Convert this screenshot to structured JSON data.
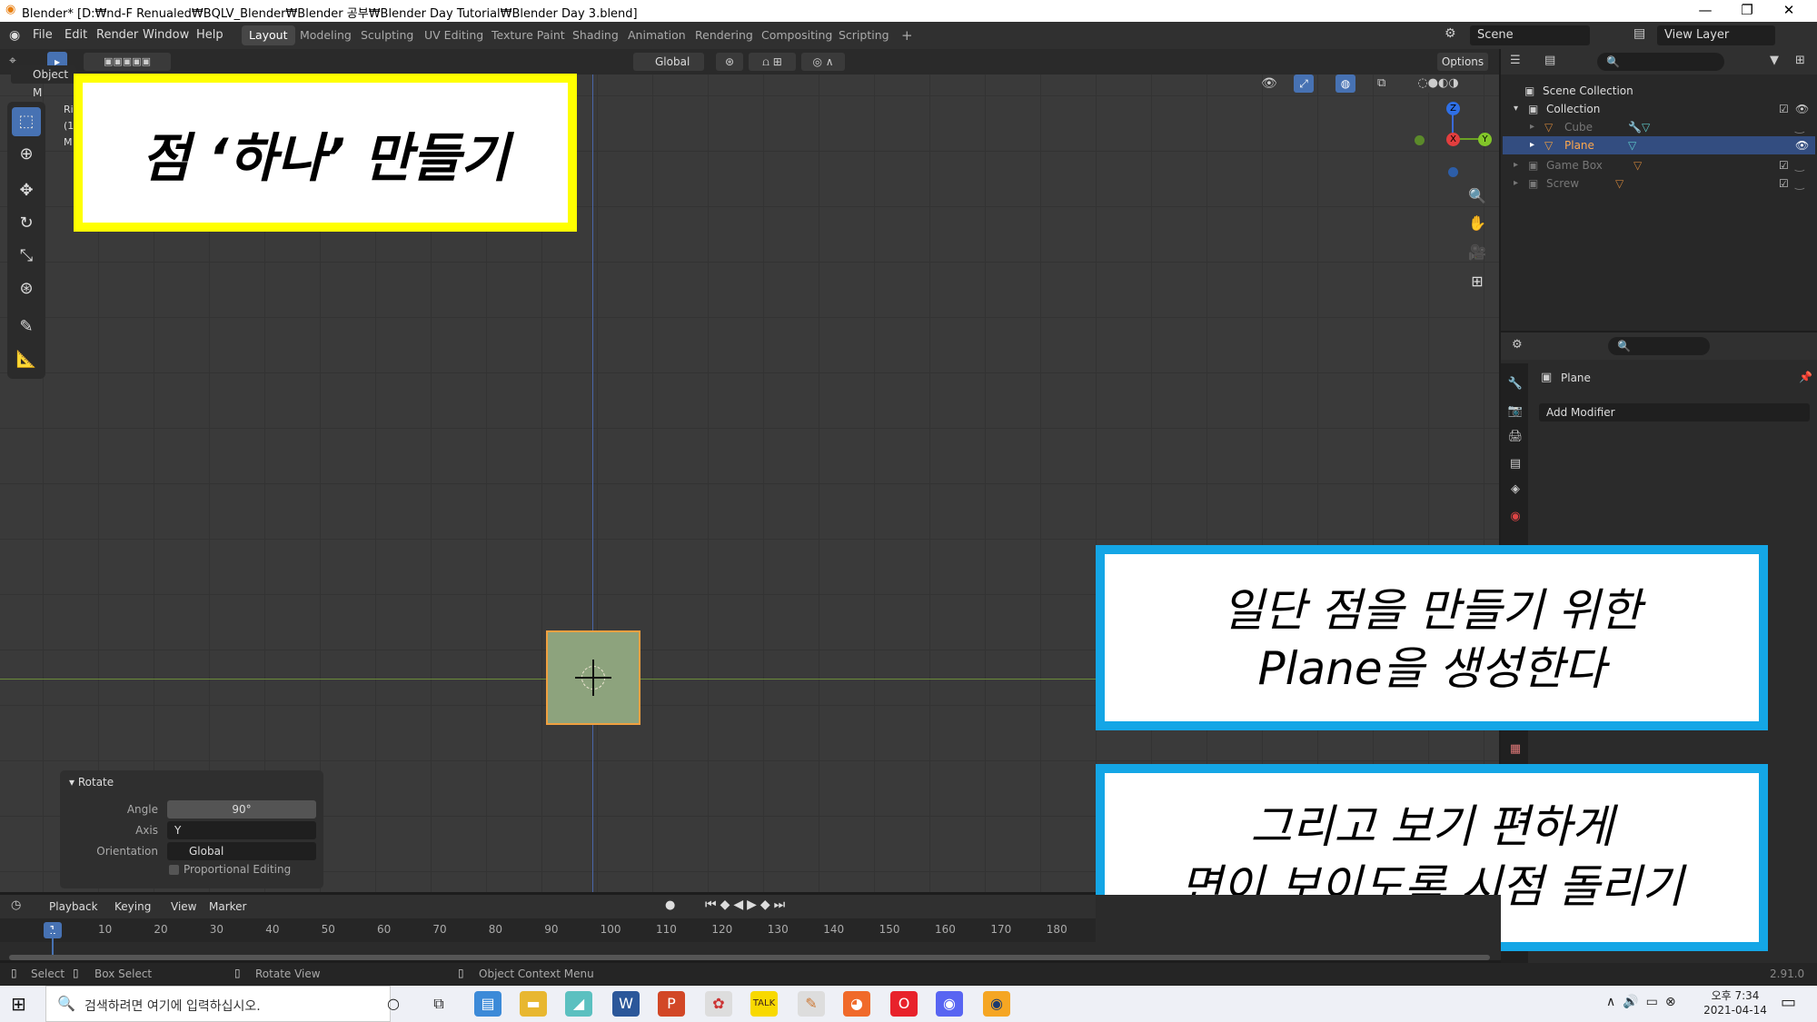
{
  "window": {
    "title": "Blender* [D:₩nd-F Renualed₩BQLV_Blender₩Blender 공부₩Blender Day Tutorial₩Blender Day 3.blend]",
    "controls": {
      "minimize": "—",
      "restore": "❐",
      "close": "✕"
    }
  },
  "menubar": {
    "menus": [
      "File",
      "Edit",
      "Render",
      "Window",
      "Help"
    ],
    "workspaces": [
      "Layout",
      "Modeling",
      "Sculpting",
      "UV Editing",
      "Texture Paint",
      "Shading",
      "Animation",
      "Rendering",
      "Compositing",
      "Scripting"
    ],
    "active_workspace": "Layout",
    "add_tab": "+",
    "scene": "Scene",
    "view_layer": "View Layer"
  },
  "viewport_header": {
    "mode": "Object M",
    "transform_orientation": "Global",
    "options": "Options",
    "overlay_lines": [
      "Ri",
      "(1",
      "M"
    ]
  },
  "rotate_panel": {
    "title": "Rotate",
    "angle_label": "Angle",
    "angle_value": "90°",
    "axis_label": "Axis",
    "axis_value": "Y",
    "orientation_label": "Orientation",
    "orientation_value": "Global",
    "proportional_label": "Proportional Editing"
  },
  "gizmo": {
    "z": "Z",
    "x": "X",
    "y": "Y"
  },
  "outliner": {
    "root": "Scene Collection",
    "collection": "Collection",
    "items": [
      {
        "name": "Cube"
      },
      {
        "name": "Plane"
      },
      {
        "name": "Game Box"
      },
      {
        "name": "Screw"
      }
    ]
  },
  "properties": {
    "object_name": "Plane",
    "add_modifier": "Add Modifier"
  },
  "timeline": {
    "menus": [
      "Playback",
      "Keying",
      "View",
      "Marker"
    ],
    "current_frame": "1",
    "ticks": [
      "10",
      "20",
      "30",
      "40",
      "50",
      "60",
      "70",
      "80",
      "90",
      "100",
      "110",
      "120",
      "130",
      "140",
      "150",
      "160",
      "170",
      "180"
    ]
  },
  "statusbar": {
    "select": "Select",
    "box_select": "Box Select",
    "rotate_view": "Rotate View",
    "context_menu": "Object Context Menu",
    "version": "2.91.0"
  },
  "taskbar": {
    "search_placeholder": "검색하려면 여기에 입력하십시오.",
    "time": "오후 7:34",
    "date": "2021-04-14"
  },
  "annotations": {
    "title_note": "점 ‘하나’ 만들기",
    "note1_line1": "일단 점을 만들기 위한",
    "note1_line2": "Plane을 생성한다",
    "note2_line1": "그리고 보기 편하게",
    "note2_line2": "면이 보이도록 시점 돌리기"
  },
  "colors": {
    "accent_blue": "#4772b3",
    "note_yellow": "#ffff00",
    "note_cyan": "#14a6e6",
    "plane_fill": "#8da37d",
    "plane_border": "#f0a040"
  }
}
